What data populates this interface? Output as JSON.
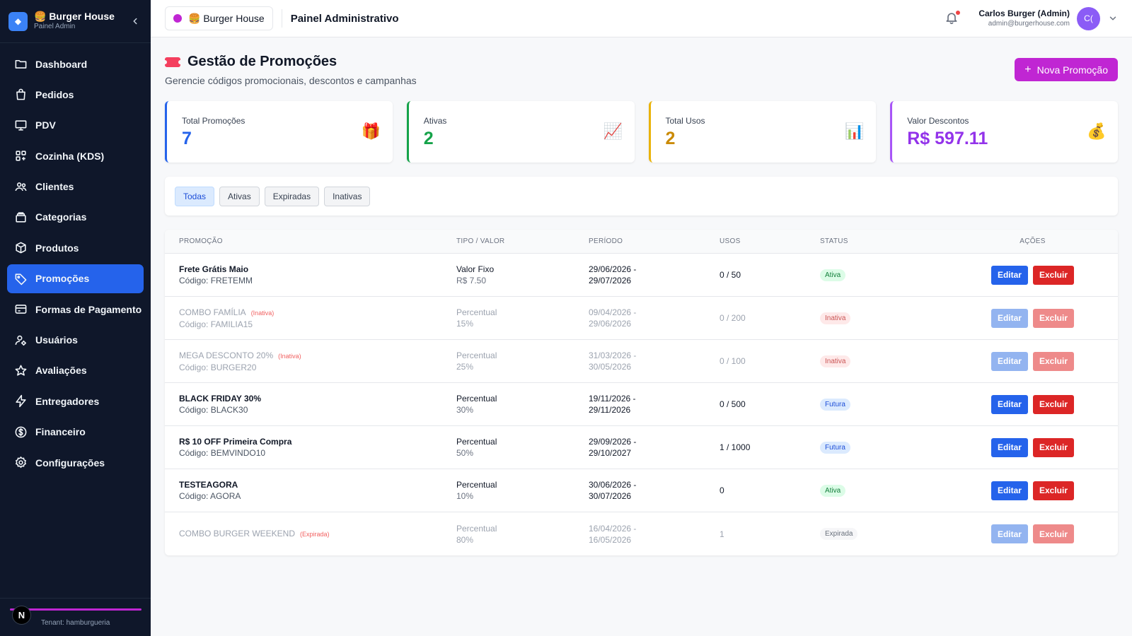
{
  "sidebar": {
    "brand_title": "🍔 Burger House",
    "brand_subtitle": "Painel Admin",
    "items": [
      {
        "label": "Dashboard",
        "icon": "folder-icon"
      },
      {
        "label": "Pedidos",
        "icon": "shopping-bag-icon"
      },
      {
        "label": "PDV",
        "icon": "monitor-icon"
      },
      {
        "label": "Cozinha (KDS)",
        "icon": "grid-icon"
      },
      {
        "label": "Clientes",
        "icon": "users-icon"
      },
      {
        "label": "Categorias",
        "icon": "layers-icon"
      },
      {
        "label": "Produtos",
        "icon": "box-icon"
      },
      {
        "label": "Promoções",
        "icon": "tag-icon",
        "active": true
      },
      {
        "label": "Formas de Pagamento",
        "icon": "credit-card-icon"
      },
      {
        "label": "Usuários",
        "icon": "user-cog-icon"
      },
      {
        "label": "Avaliações",
        "icon": "star-icon"
      },
      {
        "label": "Entregadores",
        "icon": "lightning-icon"
      },
      {
        "label": "Financeiro",
        "icon": "dollar-circle-icon"
      },
      {
        "label": "Configurações",
        "icon": "gear-icon"
      }
    ],
    "footer_badge": "N",
    "tenant": "Tenant: hamburgueria"
  },
  "header": {
    "store_name": "🍔 Burger House",
    "title": "Painel Administrativo",
    "user_name": "Carlos Burger (Admin)",
    "user_email": "admin@burgerhouse.com",
    "avatar_initials": "C("
  },
  "page": {
    "title": "Gestão de Promoções",
    "subtitle": "Gerencie códigos promocionais, descontos e campanhas",
    "new_button": "Nova Promoção"
  },
  "stats": [
    {
      "label": "Total Promoções",
      "value": "7",
      "color": "#2563eb",
      "icon": "🎁"
    },
    {
      "label": "Ativas",
      "value": "2",
      "color": "#16a34a",
      "icon": "📈"
    },
    {
      "label": "Total Usos",
      "value": "2",
      "color": "#ca8a04",
      "icon": "📊"
    },
    {
      "label": "Valor Descontos",
      "value": "R$ 597.11",
      "color": "#9333ea",
      "icon": "💰"
    }
  ],
  "filters": [
    "Todas",
    "Ativas",
    "Expiradas",
    "Inativas"
  ],
  "table": {
    "headers": [
      "PROMOÇÃO",
      "TIPO / VALOR",
      "PERÍODO",
      "USOS",
      "STATUS",
      "AÇÕES"
    ],
    "edit_label": "Editar",
    "delete_label": "Excluir",
    "rows": [
      {
        "name": "Frete Grátis Maio",
        "tag": "",
        "code": "Código: FRETEMM",
        "type": "Valor Fixo",
        "value": "R$ 7.50",
        "start": "29/06/2026 -",
        "end": "29/07/2026",
        "uses": "0 / 50",
        "status": "Ativa",
        "status_class": "b-ativa",
        "dim": false
      },
      {
        "name": "COMBO FAMÍLIA",
        "tag": "(Inativa)",
        "code": "Código: FAMILIA15",
        "type": "Percentual",
        "value": "15%",
        "start": "09/04/2026 -",
        "end": "29/06/2026",
        "uses": "0 / 200",
        "status": "Inativa",
        "status_class": "b-inativa",
        "dim": true
      },
      {
        "name": "MEGA DESCONTO 20%",
        "tag": "(Inativa)",
        "code": "Código: BURGER20",
        "type": "Percentual",
        "value": "25%",
        "start": "31/03/2026 -",
        "end": "30/05/2026",
        "uses": "0 / 100",
        "status": "Inativa",
        "status_class": "b-inativa",
        "dim": true
      },
      {
        "name": "BLACK FRIDAY 30%",
        "tag": "",
        "code": "Código: BLACK30",
        "type": "Percentual",
        "value": "30%",
        "start": "19/11/2026 -",
        "end": "29/11/2026",
        "uses": "0 / 500",
        "status": "Futura",
        "status_class": "b-futura",
        "dim": false
      },
      {
        "name": "R$ 10 OFF Primeira Compra",
        "tag": "",
        "code": "Código: BEMVINDO10",
        "type": "Percentual",
        "value": "50%",
        "start": "29/09/2026 -",
        "end": "29/10/2027",
        "uses": "1 / 1000",
        "status": "Futura",
        "status_class": "b-futura",
        "dim": false
      },
      {
        "name": "TESTEAGORA",
        "tag": "",
        "code": "Código: AGORA",
        "type": "Percentual",
        "value": "10%",
        "start": "30/06/2026 -",
        "end": "30/07/2026",
        "uses": "0",
        "status": "Ativa",
        "status_class": "b-ativa",
        "dim": false
      },
      {
        "name": "COMBO BURGER WEEKEND",
        "tag": "(Expirada)",
        "code": "",
        "type": "Percentual",
        "value": "80%",
        "start": "16/04/2026 -",
        "end": "16/05/2026",
        "uses": "1",
        "status": "Expirada",
        "status_class": "b-expirada",
        "dim": true
      }
    ]
  }
}
